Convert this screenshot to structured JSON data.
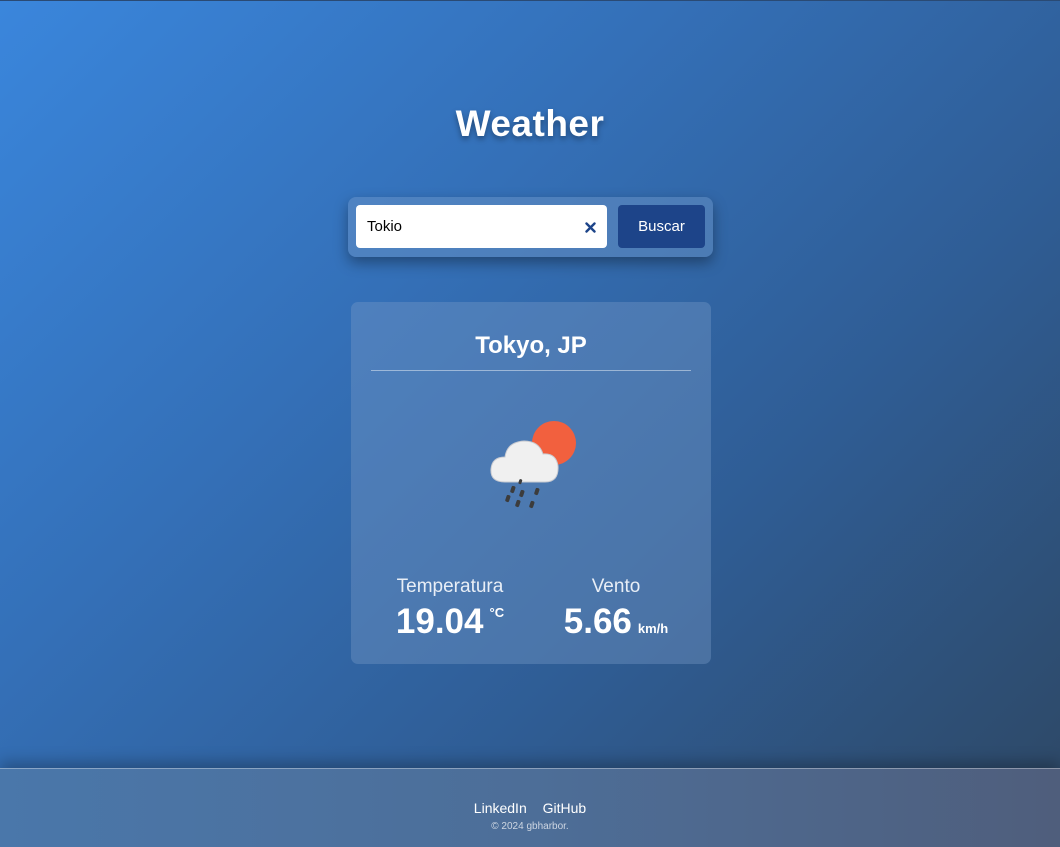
{
  "header": {
    "title": "Weather"
  },
  "search": {
    "value": "Tokio",
    "button_label": "Buscar"
  },
  "weather": {
    "city": "Tokyo, JP",
    "icon": "rain-cloud-sun-icon",
    "temperature": {
      "label": "Temperatura",
      "value": "19.04",
      "unit": "°C"
    },
    "wind": {
      "label": "Vento",
      "value": "5.66",
      "unit": "km/h"
    }
  },
  "footer": {
    "links": [
      "LinkedIn",
      "GitHub"
    ],
    "copyright": "© 2024 gbharbor."
  },
  "colors": {
    "background_start": "#3a86dc",
    "background_end": "#2e4763",
    "button": "#1d4489",
    "sun": "#f2603e",
    "cloud": "#f2f2f2"
  }
}
